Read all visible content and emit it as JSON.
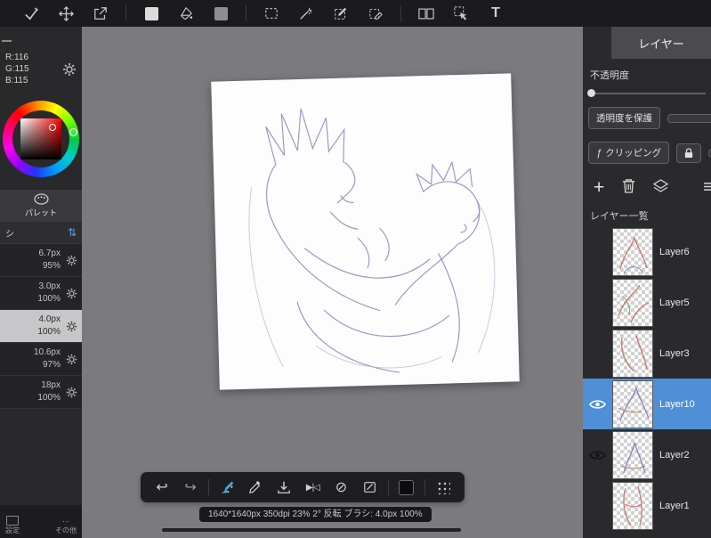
{
  "colors": {
    "selection_blue": "#4e8fd5",
    "accent_blue": "#4aa3e8",
    "topbar_bg": "#1b1b1d",
    "panel_bg": "#2a2a2c",
    "canvas_bg": "#7b7b7f"
  },
  "top_toolbar": {
    "text_tool_label": "T",
    "tools": [
      "pen-check",
      "move",
      "export",
      "fill-swatch",
      "bucket",
      "gray-swatch",
      "select-rect",
      "magic-wand",
      "select-pen",
      "select-eraser",
      "split-view",
      "object-select",
      "text"
    ]
  },
  "left_panel": {
    "color_readout": {
      "r": "R:116",
      "g": "G:115",
      "b": "B:115"
    },
    "palette_tab": "パレット",
    "brush_header": "シ",
    "sort_glyph": "⇅",
    "brushes": [
      {
        "size": "6.7px",
        "opacity": "95%"
      },
      {
        "size": "3.0px",
        "opacity": "100%"
      },
      {
        "size": "4.0px",
        "opacity": "100%",
        "selected": true
      },
      {
        "size": "10.6px",
        "opacity": "97%"
      },
      {
        "size": "18px",
        "opacity": "100%"
      }
    ],
    "footer": {
      "settings": "設定",
      "more_glyph": "⋯",
      "others": "その他"
    }
  },
  "bottom_toolbar": {
    "undo_glyph": "↩",
    "redo_glyph": "↪",
    "flip_glyph": "▶|◁",
    "rotate_off_glyph": "⊘",
    "tools": [
      "undo",
      "redo",
      "brush-sparkle",
      "eyedropper",
      "save-download",
      "flip-horizontal",
      "rotate-reset",
      "clear",
      "material-square",
      "grid-dots"
    ]
  },
  "status_bar": {
    "text": "1640*1640px 350dpi 23% 2° 反転 ブラシ: 4.0px 100%"
  },
  "right_panel": {
    "title": "レイヤー",
    "opacity_label": "不透明度",
    "protect_button": "透明度を保護",
    "clipping_button": "クリッピング",
    "clipping_fx_glyph": "ƒ",
    "add_glyph": "+",
    "layers_header": "レイヤー一覧",
    "layers": [
      {
        "name": "Layer6",
        "visible": false,
        "selected": false
      },
      {
        "name": "Layer5",
        "visible": false,
        "selected": false
      },
      {
        "name": "Layer3",
        "visible": false,
        "selected": false
      },
      {
        "name": "Layer10",
        "visible": true,
        "selected": true
      },
      {
        "name": "Layer2",
        "visible": true,
        "selected": false
      },
      {
        "name": "Layer1",
        "visible": false,
        "selected": false
      }
    ]
  }
}
